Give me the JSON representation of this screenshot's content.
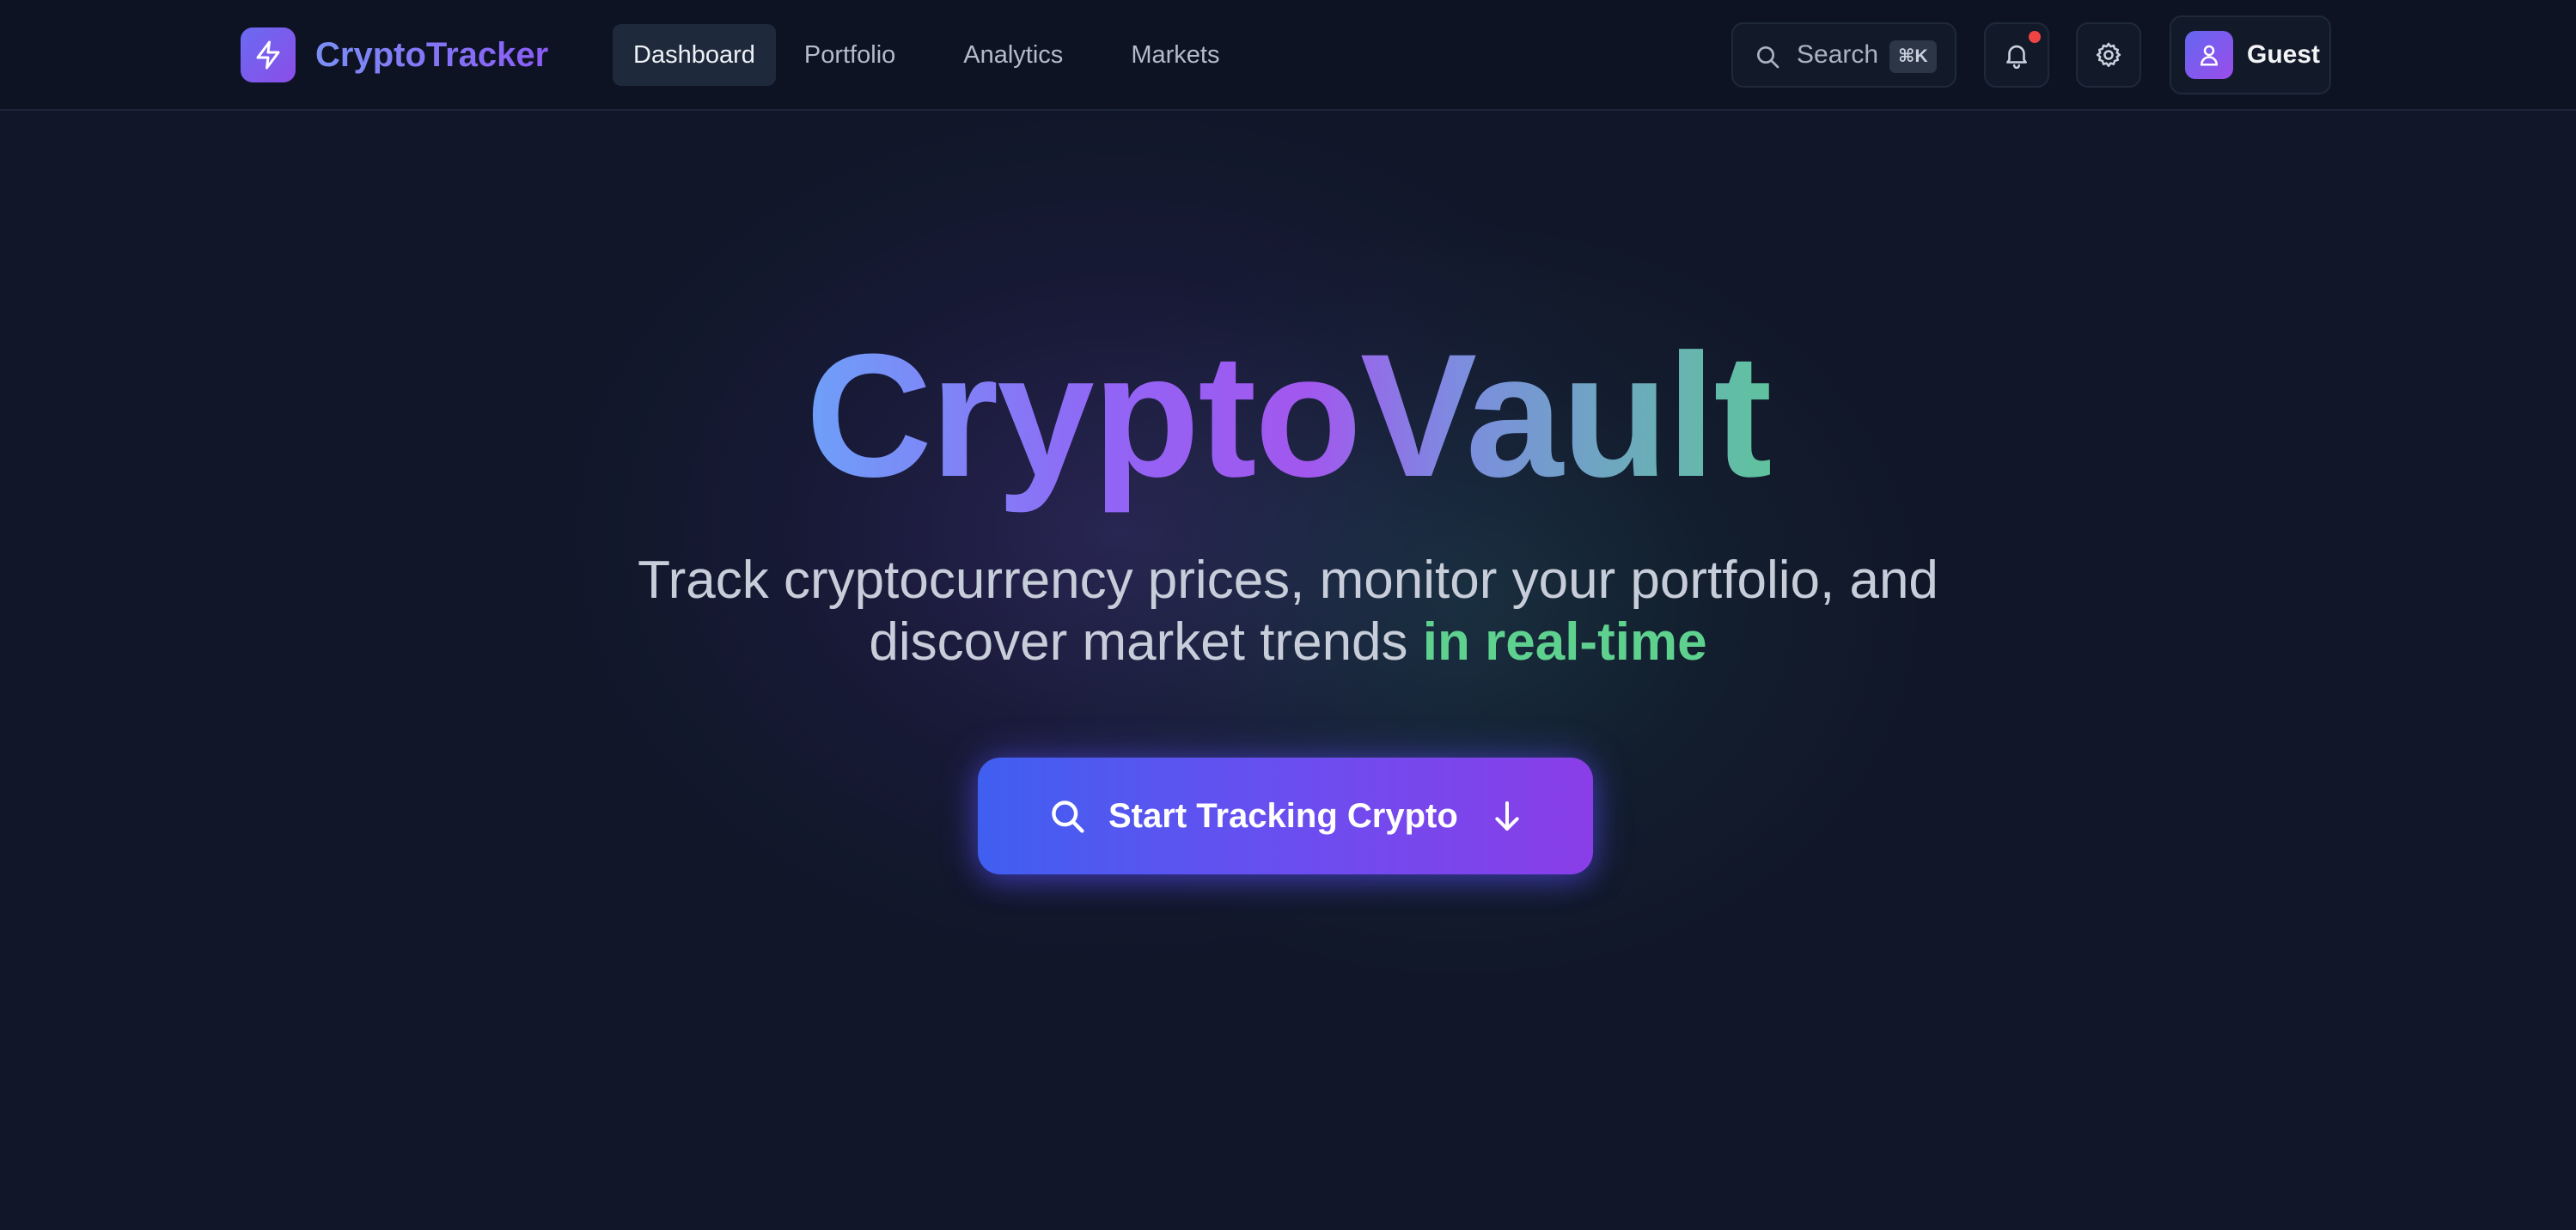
{
  "app": {
    "brand_name": "CryptoTracker",
    "accent_gradient": [
      "#6366f1",
      "#8b5cf6"
    ]
  },
  "header": {
    "nav": [
      {
        "label": "Dashboard",
        "active": true
      },
      {
        "label": "Portfolio",
        "active": false
      },
      {
        "label": "Analytics",
        "active": false
      },
      {
        "label": "Markets",
        "active": false
      }
    ],
    "search": {
      "label": "Search",
      "shortcut": "⌘K",
      "icon": "search-icon"
    },
    "notifications": {
      "icon": "bell-icon",
      "has_unread": true,
      "dot_color": "#ef4444"
    },
    "settings": {
      "icon": "gear-icon"
    },
    "user": {
      "name": "Guest",
      "icon": "user-icon"
    }
  },
  "hero": {
    "title": "CryptoVault",
    "subtitle_line1": "Track cryptocurrency prices, monitor your portfolio, and",
    "subtitle_line2": "discover market trends",
    "subtitle_highlight": "in real-time",
    "highlight_color": "#5fd18f",
    "cta_label": "Start Tracking Crypto",
    "cta_icons": [
      "search-icon",
      "arrow-down-icon"
    ]
  }
}
